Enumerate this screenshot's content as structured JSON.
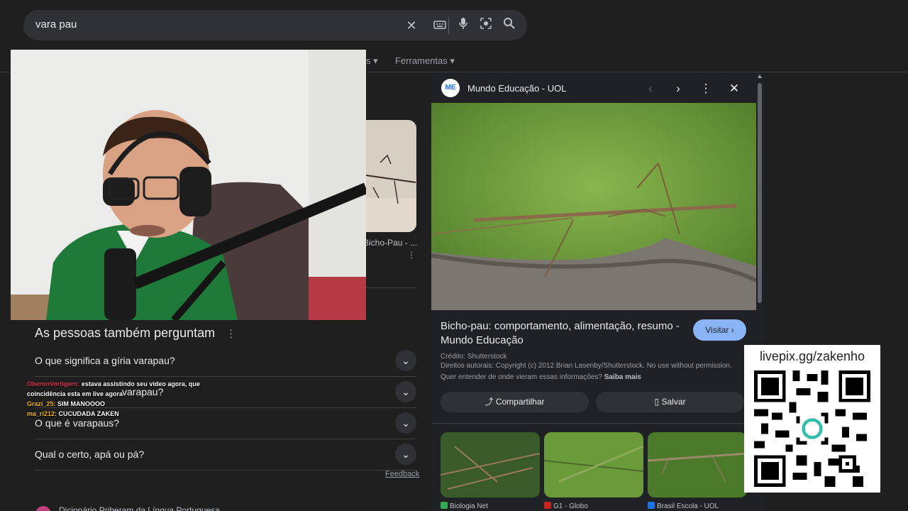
{
  "search": {
    "query": "vara pau",
    "clear_icon": "close-icon",
    "keyboard_icon": "keyboard-icon",
    "mic_icon": "microphone-icon",
    "lens_icon": "lens-icon",
    "search_icon": "search-icon"
  },
  "tabs": {
    "partial": "s",
    "tools": "Ferramentas"
  },
  "results": {
    "thumb_label": "Bicho-Pau - ...",
    "paa_title": "As pessoas também perguntam",
    "paa": [
      "O que significa a gíria varapau?",
      "varapau?",
      "O que é varapaus?",
      "Qual o certo, apá ou pá?"
    ],
    "feedback": "Feedback",
    "next_result": "Dicionário Priberam da Língua Portuguesa"
  },
  "chat": [
    {
      "user": "OberonVortigern:",
      "msg": "estava assistindo seu vídeo agora, que coincidência esta em live agora"
    },
    {
      "user": "Grazi_25:",
      "msg": "SIM MANOOOO"
    },
    {
      "user": "ma_ri212:",
      "msg": "CUCUDADA ZAKEN"
    }
  ],
  "panel": {
    "source": "Mundo Educação - UOL",
    "source_logo": "ME",
    "title": "Bicho-pau: comportamento, alimentação, resumo - Mundo Educação",
    "visit": "Visitar",
    "credit": "Crédito: Shutterstock",
    "rights": "Direitos autorais: Copyright (c) 2012 Brian Lasenby/Shutterstock. No use without permission.",
    "why": "Quer entender de onde vieram essas informações?",
    "learn_more": "Saiba mais",
    "share": "Compartilhar",
    "save": "Salvar",
    "related": [
      {
        "source": "Biologia Net",
        "color": "#34a853"
      },
      {
        "source": "G1 - Globo",
        "color": "#c5221f"
      },
      {
        "source": "Brasil Escola - UOL",
        "color": "#1a73e8"
      }
    ]
  },
  "overlay": {
    "livepix": "livepix.gg/zakenho"
  },
  "colors": {
    "background": "#1f1f1f",
    "surface": "#303134",
    "accent": "#8ab4f8"
  }
}
